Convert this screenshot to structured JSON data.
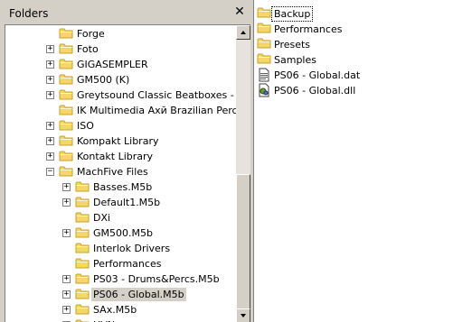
{
  "pane": {
    "title": "Folders",
    "close_symbol": "✕"
  },
  "tree": [
    {
      "label": "Forge",
      "level": 1,
      "expander": ""
    },
    {
      "label": "Foto",
      "level": 1,
      "expander": "+"
    },
    {
      "label": "GIGASEMPLER",
      "level": 1,
      "expander": "+"
    },
    {
      "label": "GM500 (K)",
      "level": 1,
      "expander": "+"
    },
    {
      "label": "Greytsound Classic Beatboxes - KONT",
      "level": 1,
      "expander": "+"
    },
    {
      "label": "IK Multimedia Ахй Brazilian Percussion",
      "level": 1,
      "expander": ""
    },
    {
      "label": "ISO",
      "level": 1,
      "expander": "+"
    },
    {
      "label": "Kompakt Library",
      "level": 1,
      "expander": "+"
    },
    {
      "label": "Kontakt Library",
      "level": 1,
      "expander": "+"
    },
    {
      "label": "MachFive Files",
      "level": 1,
      "expander": "−"
    },
    {
      "label": "Basses.M5b",
      "level": 2,
      "expander": "+"
    },
    {
      "label": "Default1.M5b",
      "level": 2,
      "expander": "+"
    },
    {
      "label": "DXi",
      "level": 2,
      "expander": ""
    },
    {
      "label": "GM500.M5b",
      "level": 2,
      "expander": "+"
    },
    {
      "label": "Interlok Drivers",
      "level": 2,
      "expander": ""
    },
    {
      "label": "Performances",
      "level": 2,
      "expander": ""
    },
    {
      "label": "PS03 - Drums&Percs.M5b",
      "level": 2,
      "expander": "+"
    },
    {
      "label": "PS06 - Global.M5b",
      "level": 2,
      "expander": "+",
      "selected": true
    },
    {
      "label": "SAx.M5b",
      "level": 2,
      "expander": "+"
    },
    {
      "label": "HVN",
      "level": 2,
      "expander": "+"
    }
  ],
  "files": [
    {
      "name": "Backup",
      "type": "folder",
      "focused": true
    },
    {
      "name": "Performances",
      "type": "folder"
    },
    {
      "name": "Presets",
      "type": "folder"
    },
    {
      "name": "Samples",
      "type": "folder"
    },
    {
      "name": "PS06 - Global.dat",
      "type": "dat-file"
    },
    {
      "name": "PS06 - Global.dll",
      "type": "dll-file"
    }
  ],
  "colors": {
    "folder": "#f5d66b",
    "folder_dark": "#c9a227",
    "selection": "#d4d0c8"
  }
}
